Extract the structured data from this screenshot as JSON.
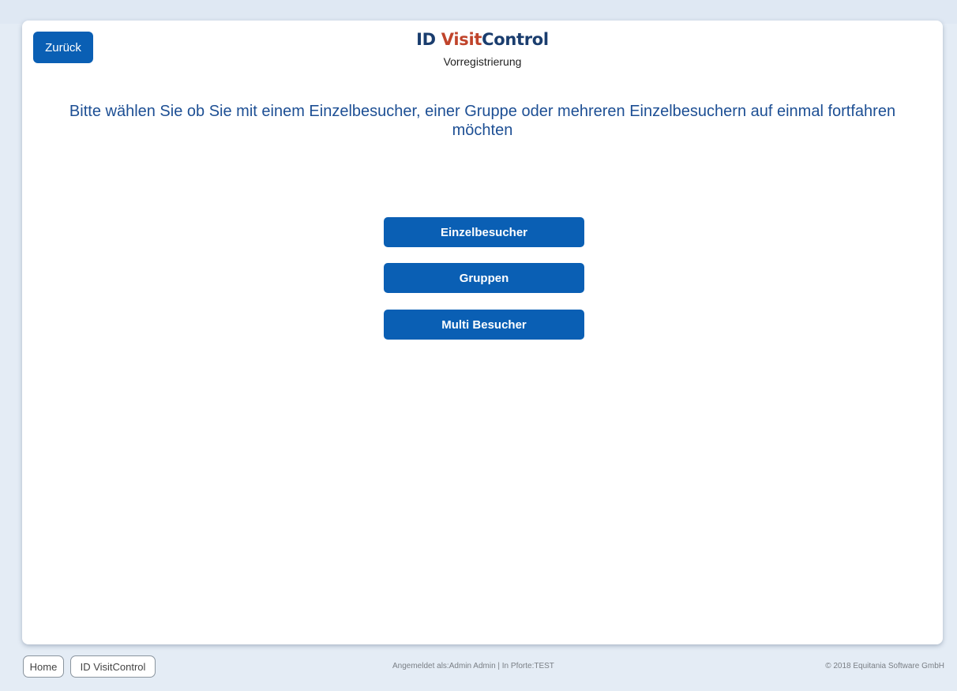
{
  "header": {
    "back_label": "Zurück",
    "logo_id": "ID ",
    "logo_visit": "Visit",
    "logo_control": "Control",
    "subtitle": "Vorregistrierung"
  },
  "main": {
    "prompt": "Bitte wählen Sie ob Sie mit einem Einzelbesucher, einer Gruppe oder mehreren Einzelbesuchern auf einmal fortfahren möchten",
    "buttons": [
      {
        "label": "Einzelbesucher"
      },
      {
        "label": "Gruppen"
      },
      {
        "label": "Multi Besucher"
      }
    ]
  },
  "footer": {
    "home_label": "Home",
    "app_label": "ID VisitControl",
    "status_text": "Angemeldet als:Admin Admin   |   In Pforte:TEST",
    "copyright": "© 2018 Equitania Software GmbH"
  },
  "colors": {
    "primary_button": "#0a5fb4",
    "prompt_text": "#1d4f94",
    "logo_dark": "#1a3d6e",
    "logo_accent": "#c0442b",
    "page_background": "#e4ecf5"
  }
}
